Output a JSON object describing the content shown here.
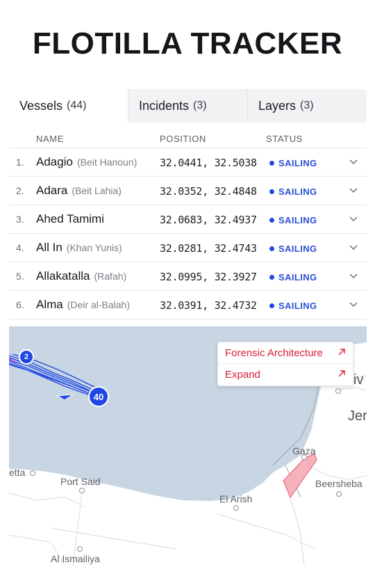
{
  "title": "FLOTILLA TRACKER",
  "tabs": [
    {
      "label": "Vessels",
      "count": "(44)"
    },
    {
      "label": "Incidents",
      "count": "(3)"
    },
    {
      "label": "Layers",
      "count": "(3)"
    }
  ],
  "table": {
    "headers": {
      "name": "NAME",
      "position": "POSITION",
      "status": "STATUS"
    },
    "rows": [
      {
        "num": "1.",
        "name": "Adagio",
        "loc": "(Beit Hanoun)",
        "pos": "32.0441, 32.5038",
        "status": "SAILING"
      },
      {
        "num": "2.",
        "name": "Adara",
        "loc": "(Beit Lahia)",
        "pos": "32.0352, 32.4848",
        "status": "SAILING"
      },
      {
        "num": "3.",
        "name": "Ahed Tamimi",
        "loc": "",
        "pos": "32.0683, 32.4937",
        "status": "SAILING"
      },
      {
        "num": "4.",
        "name": "All In",
        "loc": "(Khan Yunis)",
        "pos": "32.0281, 32.4743",
        "status": "SAILING"
      },
      {
        "num": "5.",
        "name": "Allakatalla",
        "loc": "(Rafah)",
        "pos": "32.0995, 32.3927",
        "status": "SAILING"
      },
      {
        "num": "6.",
        "name": "Alma",
        "loc": "(Deir al-Balah)",
        "pos": "32.0391, 32.4732",
        "status": "SAILING"
      }
    ]
  },
  "map": {
    "popup": {
      "item1": "Forensic Architecture",
      "item2": "Expand"
    },
    "markers": {
      "small": "2",
      "large": "40"
    },
    "labels": {
      "gaza": "Gaza",
      "port_said": "Port Said",
      "el_arish": "El Arish",
      "beersheba": "Beersheba",
      "al_ismailiya": "Al Ismailiya",
      "etta": "etta",
      "jer": "Jer",
      "iv": "iv"
    },
    "colors": {
      "sea": "#c8d5e2",
      "track": "#1f47e6",
      "gaza_zone": "#f6b2ba",
      "alert": "#d8203a"
    }
  }
}
